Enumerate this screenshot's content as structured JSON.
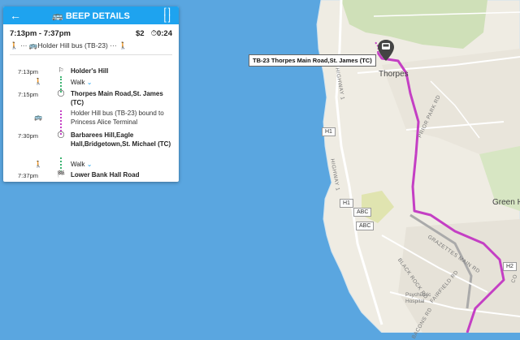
{
  "panel": {
    "back_icon": "arrow-left-icon",
    "title_icon": "bus-icon",
    "title": "BEEP DETAILS",
    "collapse_icon": "collapse-icon",
    "time_range": "7:13pm - 7:37pm",
    "price": "$2",
    "duration": "0:24",
    "mode_summary": "Holder Hill bus (TB-23)",
    "steps": [
      {
        "time": "7:13pm",
        "icon": "flag-outline-icon",
        "text": "Holder's Hill"
      },
      {
        "time": "",
        "icon": "walk-icon",
        "text": "Walk"
      },
      {
        "time": "7:15pm",
        "icon": "circle-stop-icon",
        "text": "Thorpes Main Road,St. James (TC)"
      },
      {
        "time": "",
        "icon": "bus-icon",
        "text": "Holder Hill bus (TB-23) bound to Princess Alice Terminal"
      },
      {
        "time": "7:30pm",
        "icon": "circle-stop-icon",
        "text": "Barbarees Hill,Eagle Hall,Bridgetown,St. Michael (TC)"
      },
      {
        "time": "",
        "icon": "walk-icon",
        "text": "Walk"
      },
      {
        "time": "7:37pm",
        "icon": "checkered-flag-icon",
        "text": "Lower Bank Hall Road"
      }
    ]
  },
  "map": {
    "tooltip": "TB-23 Thorpes Main Road,St. James (TC)",
    "town_thorpes": "Thorpes",
    "town_green_hill": "Green Hi",
    "road_highway1": "HIGHWAY 1",
    "road_priorpark": "PRIOR PARK RD",
    "road_grazettes": "GRAZETTES MAIN RD",
    "road_blackrock": "BLACK ROCK RD",
    "road_fairfield": "FAIRFIELD RD",
    "road_bacons": "BACONS RD",
    "road_co": "CO",
    "shield_h1a": "H1",
    "shield_h1b": "H1",
    "shield_abc1": "ABC",
    "shield_abc2": "ABC",
    "shield_h2": "H2",
    "psychiatric": "Psychiatric Hospital",
    "route_color": "#c43fc4",
    "sea_color": "#5aa6e0",
    "land_color": "#efece3"
  }
}
